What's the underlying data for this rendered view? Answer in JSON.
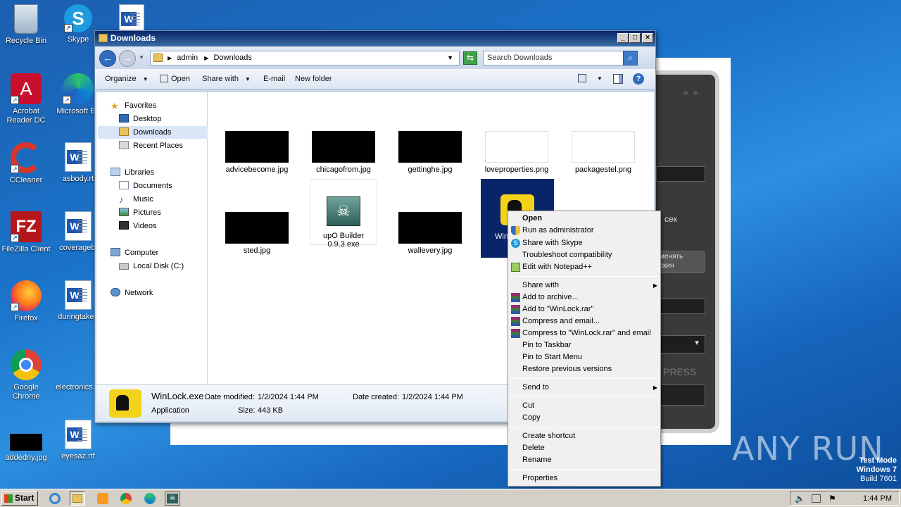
{
  "desktop": {
    "icons": [
      {
        "label": "Recycle Bin"
      },
      {
        "label": "Skype"
      },
      {
        "label": "Acrobat Reader DC"
      },
      {
        "label": "Microsoft Ed"
      },
      {
        "label": "CCleaner"
      },
      {
        "label": "asbody.rt"
      },
      {
        "label": "FileZilla Client"
      },
      {
        "label": "coveragebi"
      },
      {
        "label": "Firefox"
      },
      {
        "label": "duringtaken"
      },
      {
        "label": "Google Chrome"
      },
      {
        "label": "electronics."
      },
      {
        "label": "addedny.jpg"
      },
      {
        "label": "eyesaz.rtf"
      }
    ]
  },
  "bg_app": {
    "sec_label": "сек",
    "change_label_1": "менять",
    "change_label_2": "скин",
    "press_label": "PRESS"
  },
  "explorer": {
    "title": "Downloads",
    "address": {
      "crumbs": [
        "admin",
        "Downloads"
      ]
    },
    "search_placeholder": "Search Downloads",
    "toolbar": {
      "organize": "Organize",
      "open": "Open",
      "share_with": "Share with",
      "email": "E-mail",
      "new_folder": "New folder"
    },
    "nav": {
      "favorites": "Favorites",
      "desktop": "Desktop",
      "downloads": "Downloads",
      "recent": "Recent Places",
      "libraries": "Libraries",
      "documents": "Documents",
      "music": "Music",
      "pictures": "Pictures",
      "videos": "Videos",
      "computer": "Computer",
      "local_disk": "Local Disk (C:)",
      "network": "Network"
    },
    "files": [
      {
        "name": "advicebecome.jpg"
      },
      {
        "name": "chicagofrom.jpg"
      },
      {
        "name": "gettinghe.jpg"
      },
      {
        "name": "loveproperties.png"
      },
      {
        "name": "packagestel.png"
      },
      {
        "name": "sted.jpg"
      },
      {
        "name": "upO Builder 0.9.3.exe"
      },
      {
        "name": "wallevery.jpg"
      },
      {
        "name": "Win"
      }
    ],
    "details": {
      "name": "WinLock.exe",
      "modified_label": "Date modified:",
      "modified": "1/2/2024 1:44 PM",
      "created_label": "Date created:",
      "created": "1/2/2024 1:44 PM",
      "type": "Application",
      "size_label": "Size:",
      "size": "443 KB"
    }
  },
  "context_menu": {
    "items": [
      "Open",
      "Run as administrator",
      "Share with Skype",
      "Troubleshoot compatibility",
      "Edit with Notepad++",
      "Share with",
      "Add to archive...",
      "Add to \"WinLock.rar\"",
      "Compress and email...",
      "Compress to \"WinLock.rar\" and email",
      "Pin to Taskbar",
      "Pin to Start Menu",
      "Restore previous versions",
      "Send to",
      "Cut",
      "Copy",
      "Create shortcut",
      "Delete",
      "Rename",
      "Properties"
    ]
  },
  "taskbar": {
    "start": "Start",
    "clock": "1:44 PM"
  },
  "watermark": "ANY RUN",
  "testmode": {
    "line1": "Test Mode",
    "line2": "Windows 7",
    "line3": "Build 7601"
  }
}
